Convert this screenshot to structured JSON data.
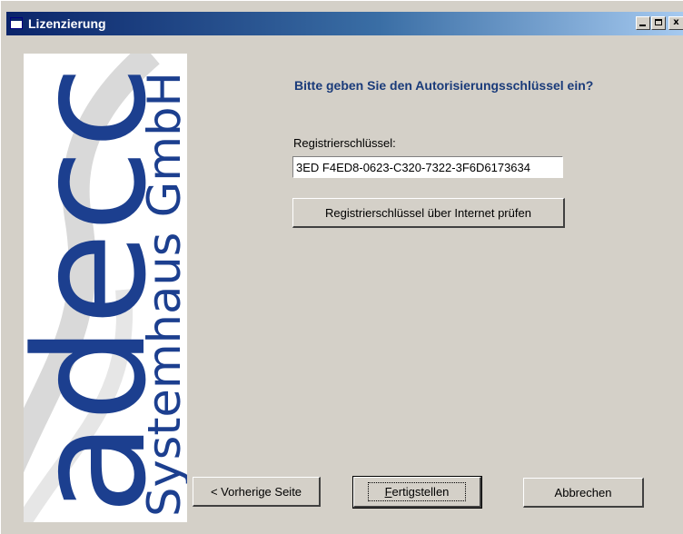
{
  "window": {
    "title": "Lizenzierung",
    "caption_buttons": {
      "minimize": "_",
      "maximize": "□",
      "close": "x"
    }
  },
  "logo": {
    "brand": "adecc",
    "company": "Systemhaus GmbH",
    "brand_color": "#1c3f8f"
  },
  "content": {
    "prompt": "Bitte geben Sie den Autorisierungsschlüssel ein?",
    "reg_label": "Registrierschlüssel:",
    "reg_value": "3ED F4ED8-0623-C320-7322-3F6D6173634",
    "check_button": "Registrierschlüssel über Internet prüfen"
  },
  "footer": {
    "prev_button": "< Vorherige Seite",
    "finish_accel": "F",
    "finish_rest": "ertigstellen",
    "cancel_button": "Abbrechen"
  }
}
